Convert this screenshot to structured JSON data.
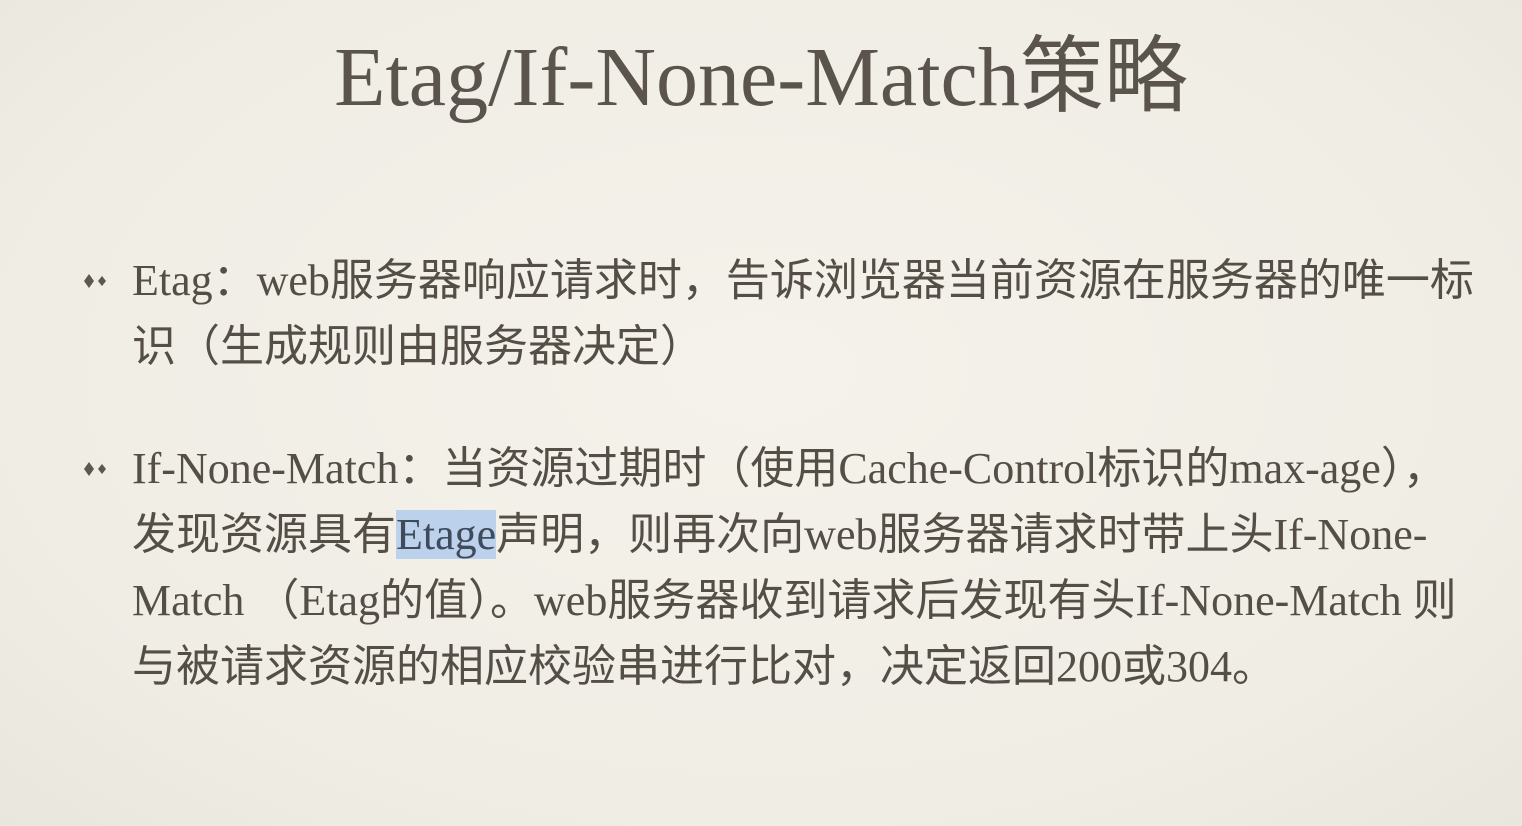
{
  "slide": {
    "title": "Etag/If-None-Match策略",
    "bullets": [
      {
        "text": "Etag：web服务器响应请求时，告诉浏览器当前资源在服务器的唯一标识（生成规则由服务器决定）"
      },
      {
        "text_before": "If-None-Match：当资源过期时（使用Cache-Control标识的max-age），发现资源具有",
        "highlighted": "Etage",
        "text_after": "声明，则再次向web服务器请求时带上头If-None-Match （Etag的值）。web服务器收到请求后发现有头If-None-Match 则与被请求资源的相应校验串进行比对，决定返回200或304。"
      }
    ]
  },
  "icons": {
    "bullet": "diamond-bullet-icon"
  },
  "colors": {
    "background": "#f1efe6",
    "text": "#544e47",
    "selection_highlight": "#bcd1ec"
  }
}
